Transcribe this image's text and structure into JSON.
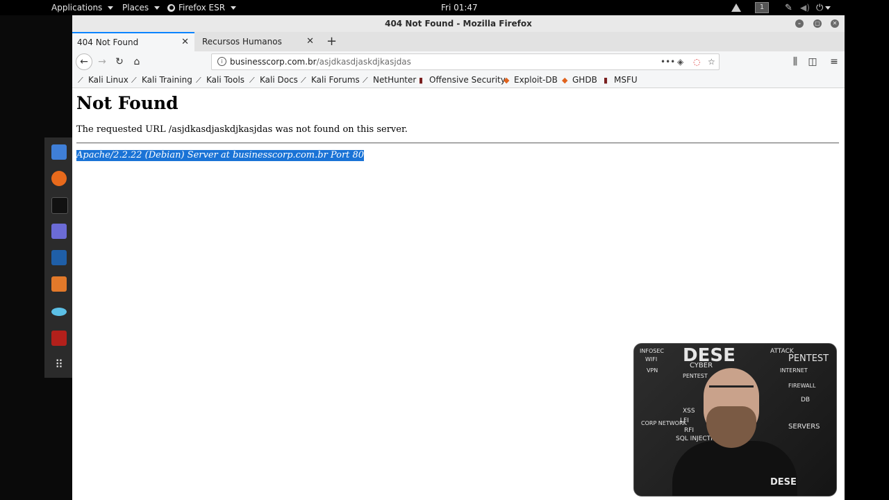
{
  "topbar": {
    "applications": "Applications",
    "places": "Places",
    "firefox_esr": "Firefox ESR",
    "clock": "Fri 01:47",
    "workspace": "1"
  },
  "window": {
    "title": "404 Not Found - Mozilla Firefox"
  },
  "tabs": [
    {
      "label": "404 Not Found",
      "active": true
    },
    {
      "label": "Recursos Humanos",
      "active": false
    }
  ],
  "urlbar": {
    "host": "businesscorp.com.br",
    "path": "/asjdkasdjaskdjkasjdas"
  },
  "bookmarks": [
    {
      "label": "Kali Linux",
      "icon": "kali-dragon-icon"
    },
    {
      "label": "Kali Training",
      "icon": "kali-dragon-icon"
    },
    {
      "label": "Kali Tools",
      "icon": "kali-dragon-icon"
    },
    {
      "label": "Kali Docs",
      "icon": "kali-dragon-icon"
    },
    {
      "label": "Kali Forums",
      "icon": "kali-dragon-icon"
    },
    {
      "label": "NetHunter",
      "icon": "kali-dragon-icon"
    },
    {
      "label": "Offensive Security",
      "icon": "offsec-icon"
    },
    {
      "label": "Exploit-DB",
      "icon": "exploitdb-icon"
    },
    {
      "label": "GHDB",
      "icon": "exploitdb-icon"
    },
    {
      "label": "MSFU",
      "icon": "offsec-icon"
    }
  ],
  "page": {
    "heading": "Not Found",
    "message": "The requested URL /asjdkasdjaskdjkasjdas was not found on this server.",
    "address": "Apache/2.2.22 (Debian) Server at businesscorp.com.br Port 80"
  },
  "webcam": {
    "wall_words": [
      "DESE",
      "CYBER",
      "PENTEST",
      "INFOSEC",
      "WIFI",
      "VPN",
      "XSS",
      "LFI",
      "RFI",
      "SQL INJECTION",
      "CORP NETWORK",
      "PENTEST",
      "INTERNET",
      "FIREWALL",
      "DB",
      "SERVERS",
      "ATTACK"
    ],
    "shirt_logo": "DESE"
  },
  "colors": {
    "accent": "#0a84ff",
    "selection": "#1a73d6"
  }
}
